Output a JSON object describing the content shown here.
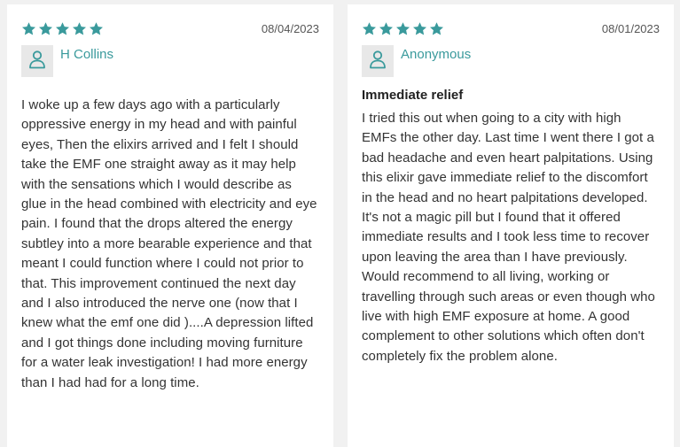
{
  "colors": {
    "star": "#3a9a9c",
    "author": "#3a9a9c",
    "avatar_bg": "#e8e8e8",
    "page_bg": "#f1f1f1",
    "card_bg": "#ffffff"
  },
  "reviews": [
    {
      "rating": 5,
      "date": "08/04/2023",
      "author": "H Collins",
      "avatar_icon": "user-icon",
      "title": "",
      "body": "I woke up a few days ago with a particularly oppressive energy in my head and with painful eyes, Then the elixirs arrived and I felt I should take the EMF one straight away as it may help with the sensations which I would describe as glue in the head combined with electricity and eye pain. I found that the drops altered the energy subtley into a more bearable experience and that meant I could function where I could not prior to that. This improvement continued the next day and I also introduced the nerve one (now that I knew what the emf one did )....A depression lifted and I got things done including moving furniture for a water leak investigation! I had more energy than I had had for a long time."
    },
    {
      "rating": 5,
      "date": "08/01/2023",
      "author": "Anonymous",
      "avatar_icon": "user-icon",
      "title": "Immediate relief",
      "body": "I tried this out when going to a city with high EMFs the other day. Last time I went there I got a bad headache and even heart palpitations. Using this elixir gave immediate relief to the discomfort in the head and no heart palpitations developed. It's not a magic pill but I found that it offered immediate results and I took less time to recover upon leaving the area than I have previously. Would recommend to all living, working or travelling through such areas or even though who live with high EMF exposure at home. A good complement to other solutions which often don't completely fix the problem alone."
    }
  ]
}
